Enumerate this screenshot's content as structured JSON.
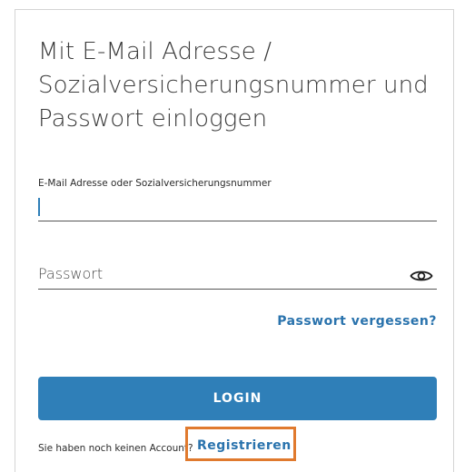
{
  "login": {
    "title": "Mit E-Mail Adresse / Sozialversicherungsnummer und Passwort einloggen",
    "email_label": "E-Mail Adresse oder Sozialversicherungsnummer",
    "email_value": "",
    "password_placeholder": "Passwort",
    "password_value": "",
    "visibility_icon": "eye-icon",
    "forgot_link": "Passwort vergessen?",
    "login_button": "LOGIN",
    "no_account_text": "Sie haben noch keinen Account?",
    "register_link": "Registrieren"
  },
  "colors": {
    "accent": "#2f7fb8",
    "link": "#2a73ad",
    "highlight": "#e07a2e"
  }
}
